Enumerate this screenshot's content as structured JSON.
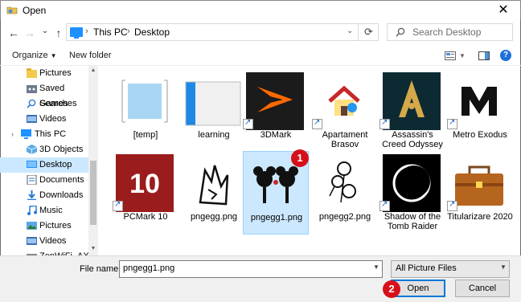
{
  "window": {
    "title": "Open",
    "close_glyph": "✕"
  },
  "nav": {
    "back": "←",
    "forward": "→",
    "recent": "⌄",
    "up": "↑",
    "breadcrumbs": [
      "This PC",
      "Desktop"
    ],
    "separator": "›",
    "refresh": "⟳",
    "search_placeholder": "Search Desktop"
  },
  "commands": {
    "organize": "Organize",
    "new_folder": "New folder",
    "help": "?"
  },
  "sidebar": {
    "items": [
      {
        "label": "Pictures",
        "icon": "folder-icon",
        "root": false
      },
      {
        "label": "Saved Games",
        "icon": "saved-games-icon",
        "root": false
      },
      {
        "label": "Searches",
        "icon": "search-icon",
        "root": false
      },
      {
        "label": "Videos",
        "icon": "videos-icon",
        "root": false
      },
      {
        "label": "This PC",
        "icon": "monitor-icon",
        "root": true
      },
      {
        "label": "3D Objects",
        "icon": "cube-icon",
        "root": false
      },
      {
        "label": "Desktop",
        "icon": "desktop-icon",
        "root": false,
        "selected": true
      },
      {
        "label": "Documents",
        "icon": "documents-icon",
        "root": false
      },
      {
        "label": "Downloads",
        "icon": "download-icon",
        "root": false
      },
      {
        "label": "Music",
        "icon": "music-icon",
        "root": false
      },
      {
        "label": "Pictures",
        "icon": "pictures-icon",
        "root": false
      },
      {
        "label": "Videos",
        "icon": "videos-icon",
        "root": false
      },
      {
        "label": "ZenWiFi_AX",
        "icon": "drive-icon",
        "root": false
      }
    ]
  },
  "files": [
    {
      "label": "[temp]",
      "kind": "empty-folder"
    },
    {
      "label": "learning",
      "kind": "folder"
    },
    {
      "label": "3DMark",
      "kind": "3dmark",
      "shortcut": true
    },
    {
      "label": "Apartament Brasov",
      "kind": "house",
      "shortcut": true
    },
    {
      "label": "Assassin's Creed Odyssey",
      "kind": "ac",
      "shortcut": true
    },
    {
      "label": "Metro Exodus",
      "kind": "metro",
      "shortcut": true
    },
    {
      "label": "PCMark 10",
      "kind": "pcmark",
      "shortcut": true
    },
    {
      "label": "pngegg.png",
      "kind": "wolf"
    },
    {
      "label": "pngegg1.png",
      "kind": "mickey",
      "selected": true
    },
    {
      "label": "pngegg2.png",
      "kind": "floral"
    },
    {
      "label": "Shadow of the Tomb Raider",
      "kind": "eclipse",
      "shortcut": true
    },
    {
      "label": "Titularizare 2020",
      "kind": "briefcase",
      "shortcut": true
    }
  ],
  "footer": {
    "filename_label": "File name:",
    "filename_value": "pngegg1.png",
    "filter_value": "All Picture Files",
    "open_label": "Open",
    "cancel_label": "Cancel"
  },
  "badges": {
    "one": "1",
    "two": "2"
  },
  "colors": {
    "accent": "#0078d7",
    "selection": "#cce8ff",
    "badge": "#d6101b"
  }
}
